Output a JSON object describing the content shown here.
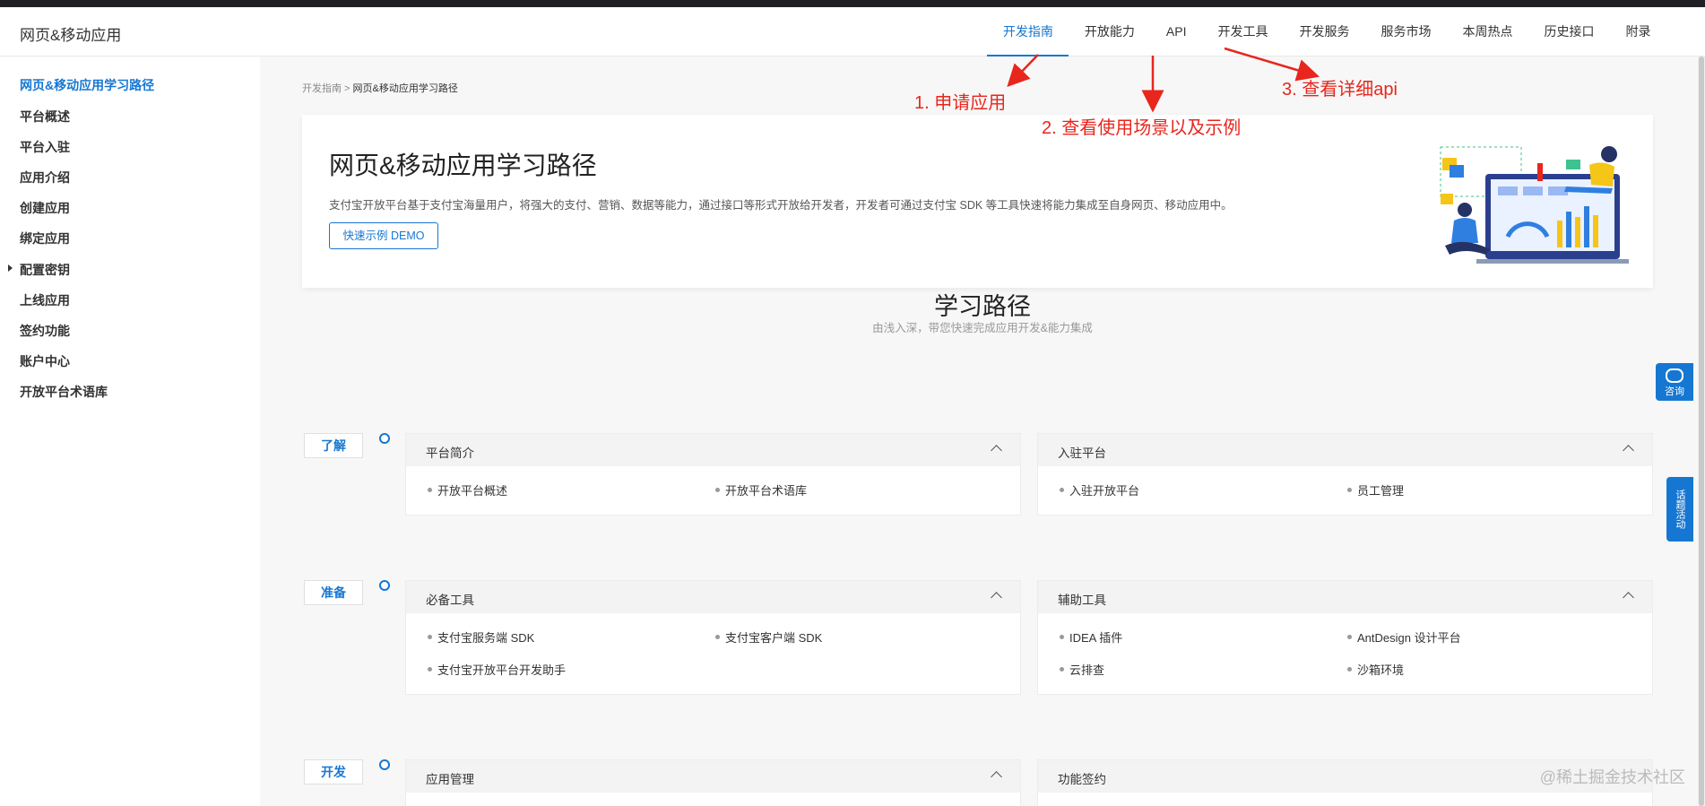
{
  "header": {
    "brand": "网页&移动应用",
    "nav": [
      "开发指南",
      "开放能力",
      "API",
      "开发工具",
      "开发服务",
      "服务市场",
      "本周热点",
      "历史接口",
      "附录"
    ]
  },
  "sidebar": {
    "items": [
      "网页&移动应用学习路径",
      "平台概述",
      "平台入驻",
      "应用介绍",
      "创建应用",
      "绑定应用",
      "配置密钥",
      "上线应用",
      "签约功能",
      "账户中心",
      "开放平台术语库"
    ]
  },
  "breadcrumb": {
    "parent": "开发指南",
    "separator": " > ",
    "current": "网页&移动应用学习路径"
  },
  "hero": {
    "title": "网页&移动应用学习路径",
    "desc": "支付宝开放平台基于支付宝海量用户，将强大的支付、营销、数据等能力，通过接口等形式开放给开发者，开发者可通过支付宝 SDK 等工具快速将能力集成至自身网页、移动应用中。",
    "button": "快速示例 DEMO"
  },
  "section": {
    "title": "学习路径",
    "subtitle": "由浅入深，带您快速完成应用开发&能力集成"
  },
  "stages": [
    {
      "tag": "了解",
      "cards": [
        {
          "title": "平台简介",
          "items": [
            "开放平台概述",
            "开放平台术语库"
          ]
        },
        {
          "title": "入驻平台",
          "items": [
            "入驻开放平台",
            "员工管理"
          ]
        }
      ]
    },
    {
      "tag": "准备",
      "cards": [
        {
          "title": "必备工具",
          "items": [
            "支付宝服务端 SDK",
            "支付宝客户端 SDK",
            "支付宝开放平台开发助手"
          ]
        },
        {
          "title": "辅助工具",
          "items": [
            "IDEA 插件",
            "AntDesign 设计平台",
            "云排查",
            "沙箱环境"
          ]
        }
      ]
    },
    {
      "tag": "开发",
      "cards": [
        {
          "title": "应用管理",
          "items": []
        },
        {
          "title": "功能签约",
          "items": []
        }
      ]
    }
  ],
  "float": {
    "consult": "咨询",
    "activity": "话题活动"
  },
  "annotations": [
    "1. 申请应用",
    "2. 查看使用场景以及示例",
    "3. 查看详细api"
  ],
  "watermark": "@稀土掘金技术社区",
  "colors": {
    "accent": "#1677d2",
    "annotation": "#e8261d"
  }
}
